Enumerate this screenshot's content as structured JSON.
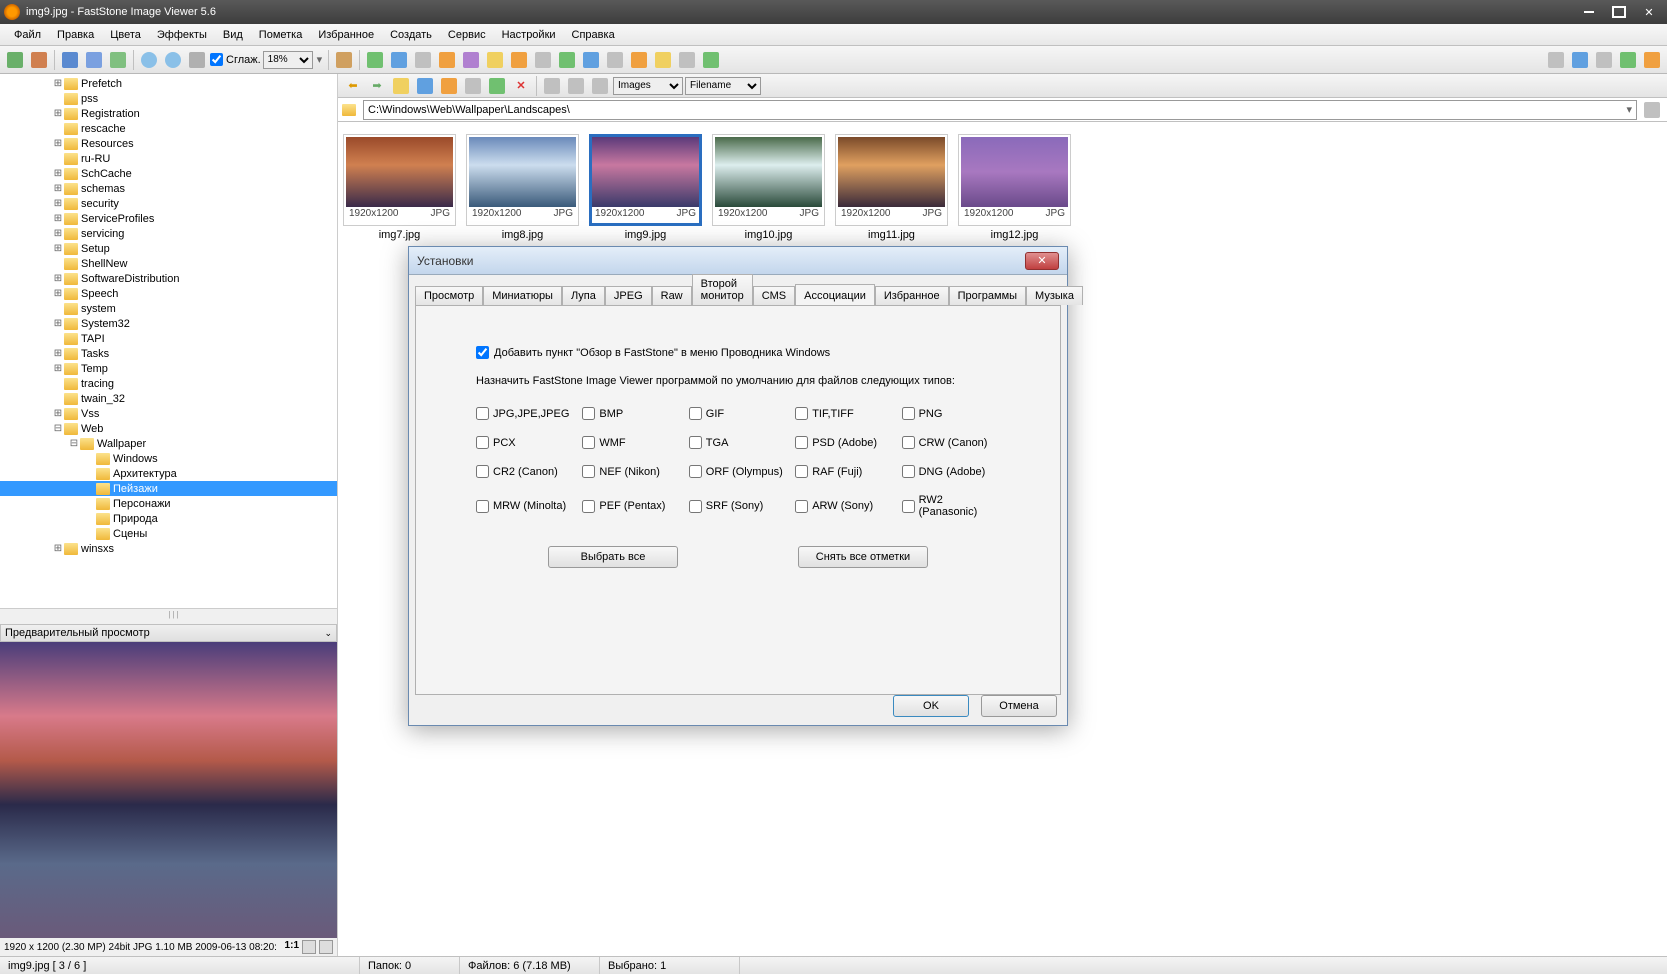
{
  "titlebar": {
    "title": "img9.jpg  -  FastStone Image Viewer 5.6"
  },
  "menu": [
    "Файл",
    "Правка",
    "Цвета",
    "Эффекты",
    "Вид",
    "Пометка",
    "Избранное",
    "Создать",
    "Сервис",
    "Настройки",
    "Справка"
  ],
  "toolbar": {
    "smooth_label": "Сглаж.",
    "zoom_value": "18%"
  },
  "tree": [
    {
      "indent": 3,
      "exp": "has",
      "name": "Prefetch"
    },
    {
      "indent": 3,
      "exp": "",
      "name": "pss"
    },
    {
      "indent": 3,
      "exp": "has",
      "name": "Registration"
    },
    {
      "indent": 3,
      "exp": "",
      "name": "rescache"
    },
    {
      "indent": 3,
      "exp": "has",
      "name": "Resources"
    },
    {
      "indent": 3,
      "exp": "",
      "name": "ru-RU"
    },
    {
      "indent": 3,
      "exp": "has",
      "name": "SchCache"
    },
    {
      "indent": 3,
      "exp": "has",
      "name": "schemas"
    },
    {
      "indent": 3,
      "exp": "has",
      "name": "security"
    },
    {
      "indent": 3,
      "exp": "has",
      "name": "ServiceProfiles"
    },
    {
      "indent": 3,
      "exp": "has",
      "name": "servicing"
    },
    {
      "indent": 3,
      "exp": "has",
      "name": "Setup"
    },
    {
      "indent": 3,
      "exp": "",
      "name": "ShellNew"
    },
    {
      "indent": 3,
      "exp": "has",
      "name": "SoftwareDistribution"
    },
    {
      "indent": 3,
      "exp": "has",
      "name": "Speech"
    },
    {
      "indent": 3,
      "exp": "",
      "name": "system"
    },
    {
      "indent": 3,
      "exp": "has",
      "name": "System32"
    },
    {
      "indent": 3,
      "exp": "",
      "name": "TAPI"
    },
    {
      "indent": 3,
      "exp": "has",
      "name": "Tasks"
    },
    {
      "indent": 3,
      "exp": "has",
      "name": "Temp"
    },
    {
      "indent": 3,
      "exp": "",
      "name": "tracing"
    },
    {
      "indent": 3,
      "exp": "",
      "name": "twain_32"
    },
    {
      "indent": 3,
      "exp": "has",
      "name": "Vss"
    },
    {
      "indent": 3,
      "exp": "open",
      "name": "Web"
    },
    {
      "indent": 4,
      "exp": "open",
      "name": "Wallpaper"
    },
    {
      "indent": 5,
      "exp": "",
      "name": "Windows"
    },
    {
      "indent": 5,
      "exp": "",
      "name": "Архитектура"
    },
    {
      "indent": 5,
      "exp": "",
      "name": "Пейзажи",
      "selected": true
    },
    {
      "indent": 5,
      "exp": "",
      "name": "Персонажи"
    },
    {
      "indent": 5,
      "exp": "",
      "name": "Природа"
    },
    {
      "indent": 5,
      "exp": "",
      "name": "Сцены"
    },
    {
      "indent": 3,
      "exp": "has",
      "name": "winsxs"
    }
  ],
  "preview": {
    "header": "Предварительный просмотр",
    "info": "1920 x 1200 (2.30 MP)  24bit  JPG   1.10 MB   2009-06-13 08:20:"
  },
  "nav": {
    "filter1": "Images",
    "filter2": "Filename"
  },
  "address": "C:\\Windows\\Web\\Wallpaper\\Landscapes\\",
  "thumbs": [
    {
      "cls": "t1",
      "res": "1920x1200",
      "fmt": "JPG",
      "name": "img7.jpg"
    },
    {
      "cls": "t2",
      "res": "1920x1200",
      "fmt": "JPG",
      "name": "img8.jpg"
    },
    {
      "cls": "t3",
      "res": "1920x1200",
      "fmt": "JPG",
      "name": "img9.jpg",
      "selected": true
    },
    {
      "cls": "t4",
      "res": "1920x1200",
      "fmt": "JPG",
      "name": "img10.jpg"
    },
    {
      "cls": "t5",
      "res": "1920x1200",
      "fmt": "JPG",
      "name": "img11.jpg"
    },
    {
      "cls": "t6",
      "res": "1920x1200",
      "fmt": "JPG",
      "name": "img12.jpg"
    }
  ],
  "dialog": {
    "title": "Установки",
    "tabs": [
      "Просмотр",
      "Миниатюры",
      "Лупа",
      "JPEG",
      "Raw",
      "Второй монитор",
      "CMS",
      "Ассоциации",
      "Избранное",
      "Программы",
      "Музыка"
    ],
    "active_tab": 7,
    "add_context_label": "Добавить пункт \"Обзор в FastStone\" в меню Проводника Windows",
    "instr": "Назначить FastStone Image Viewer программой по умолчанию для файлов следующих типов:",
    "formats": [
      "JPG,JPE,JPEG",
      "BMP",
      "GIF",
      "TIF,TIFF",
      "PNG",
      "PCX",
      "WMF",
      "TGA",
      "PSD (Adobe)",
      "CRW (Canon)",
      "CR2 (Canon)",
      "NEF (Nikon)",
      "ORF (Olympus)",
      "RAF (Fuji)",
      "DNG (Adobe)",
      "MRW (Minolta)",
      "PEF (Pentax)",
      "SRF (Sony)",
      "ARW (Sony)",
      "RW2 (Panasonic)"
    ],
    "select_all": "Выбрать все",
    "clear_all": "Снять все отметки",
    "ok": "OK",
    "cancel": "Отмена"
  },
  "status": {
    "file": "img9.jpg [ 3 / 6 ]",
    "folders": "Папок: 0",
    "files": "Файлов: 6 (7.18 MB)",
    "selected": "Выбрано: 1"
  }
}
